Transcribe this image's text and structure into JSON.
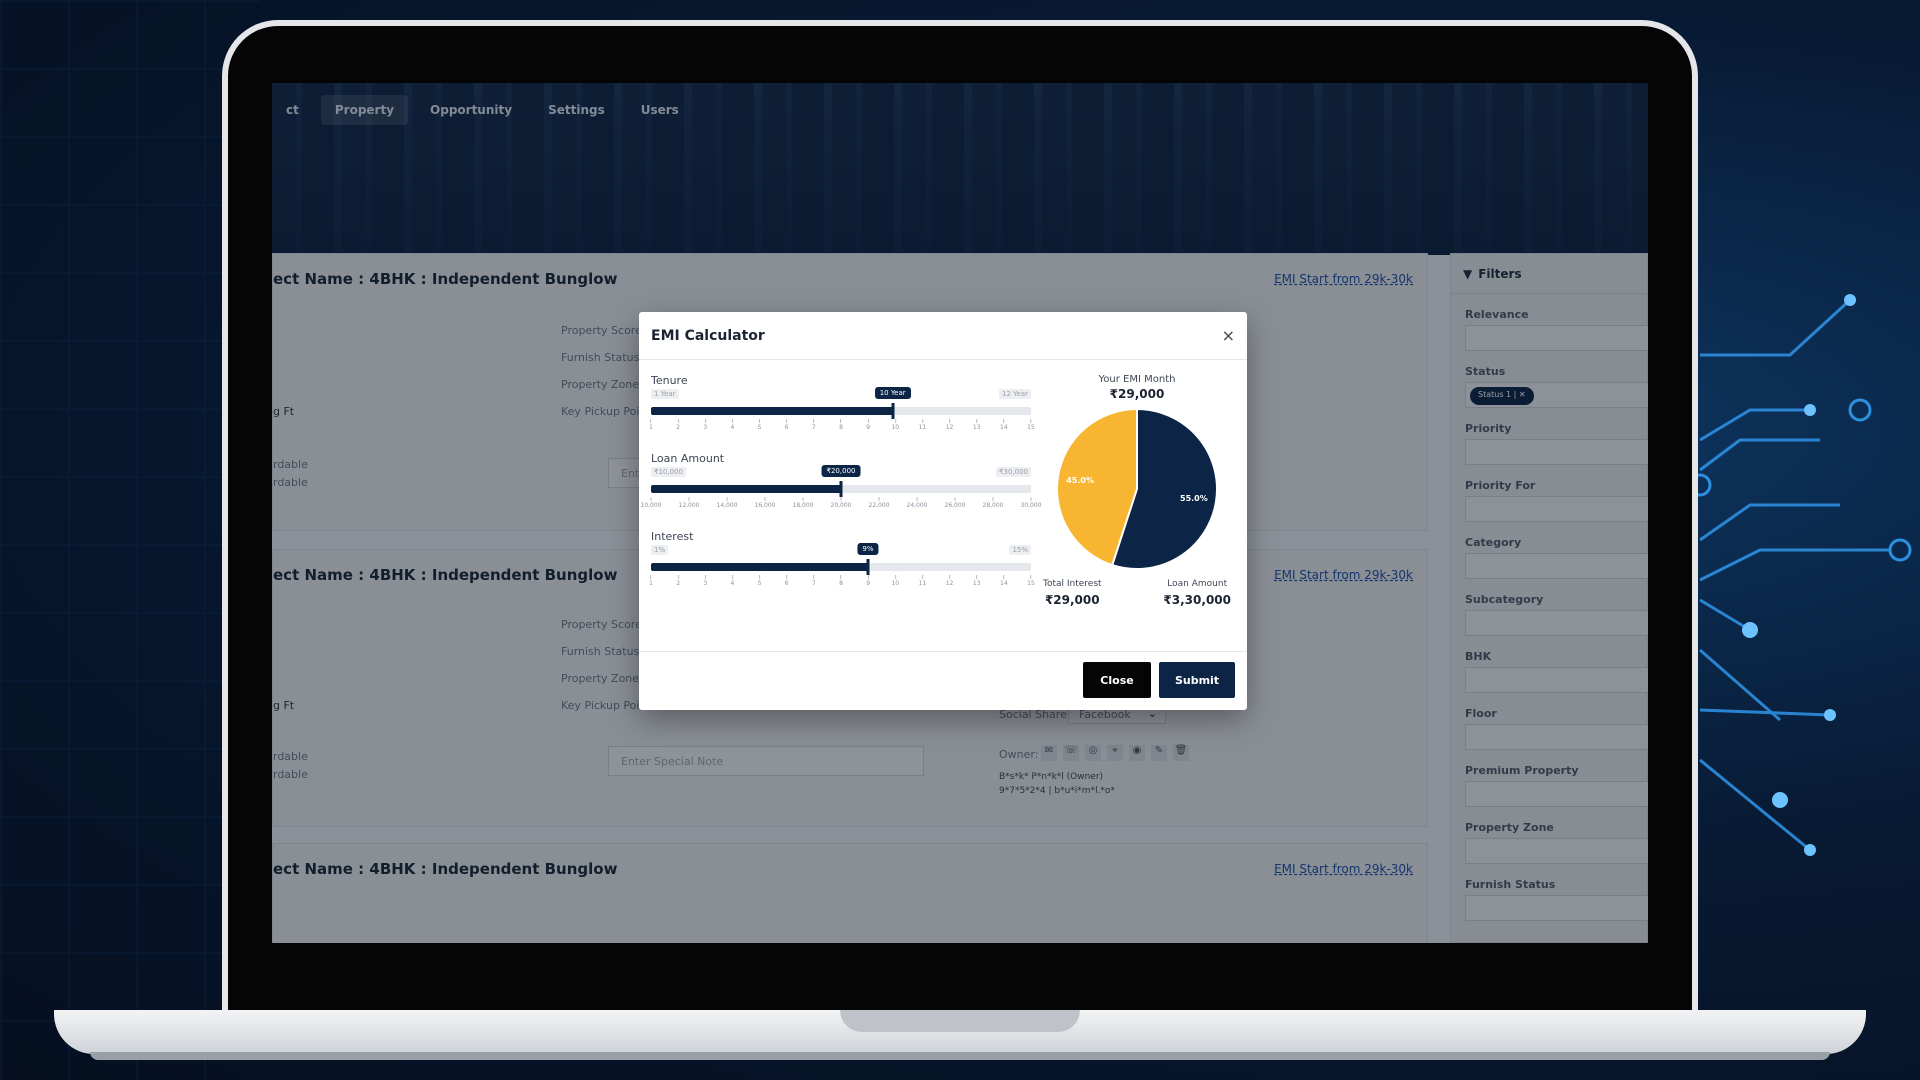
{
  "nav": {
    "items": [
      {
        "label": "ct"
      },
      {
        "label": "Property"
      },
      {
        "label": "Opportunity"
      },
      {
        "label": "Settings"
      },
      {
        "label": "Users"
      }
    ]
  },
  "cards": [
    {
      "title": "ect Name : 4BHK : Independent Bunglow",
      "emi_link": "EMI Start from 29k-30k",
      "fields": [
        "Property Score:",
        "Furnish Status: F",
        "Property Zone: ,",
        "Key Pickup Poi"
      ],
      "left_text": [
        "g Ft",
        "rdable",
        "rdable"
      ],
      "note_placeholder": "Ente"
    },
    {
      "title": "ect Name : 4BHK : Independent Bunglow",
      "emi_link": "EMI Start from 29k-30k",
      "fields": [
        "Property Score:",
        "Furnish Status:",
        "Property Zone:",
        "Key Pickup Poi"
      ],
      "left_text": [
        "g Ft",
        "rdable",
        "rdable"
      ],
      "note_placeholder": "Enter Special Note",
      "social_share_label": "Social Share:",
      "social_share_value": "Facebook",
      "owner_label": "Owner:",
      "owner_lines": [
        "B*s*k* P*n*k*l (Owner)",
        "9*7*5*2*4 | b*u*i*m*l.*o*"
      ]
    },
    {
      "title": "ect Name : 4BHK : Independent Bunglow",
      "emi_link": "EMI Start from 29k-30k"
    }
  ],
  "filters": {
    "title": "Filters",
    "groups": [
      {
        "label": "Relevance"
      },
      {
        "label": "Status",
        "chip": "Status 1"
      },
      {
        "label": "Priority"
      },
      {
        "label": "Priority For"
      },
      {
        "label": "Category"
      },
      {
        "label": "Subcategory"
      },
      {
        "label": "BHK"
      },
      {
        "label": "Floor"
      },
      {
        "label": "Premium Property"
      },
      {
        "label": "Property Zone"
      },
      {
        "label": "Furnish Status"
      }
    ]
  },
  "modal": {
    "title": "EMI Calculator",
    "close_symbol": "×",
    "tenure": {
      "label": "Tenure",
      "min_label": "1 Year",
      "max_label": "12 Year",
      "value_label": "10 Year",
      "value_fraction": 0.636,
      "ticks": [
        "1",
        "2",
        "3",
        "4",
        "5",
        "6",
        "7",
        "8",
        "9",
        "10",
        "11",
        "12",
        "13",
        "14",
        "15"
      ]
    },
    "loan": {
      "label": "Loan Amount",
      "min_label": "₹10,000",
      "max_label": "₹30,000",
      "value_label": "₹20,000",
      "value_fraction": 0.5,
      "ticks": [
        "10,000",
        "12,000",
        "14,000",
        "16,000",
        "18,000",
        "20,000",
        "22,000",
        "24,000",
        "26,000",
        "28,000",
        "30,000"
      ]
    },
    "interest": {
      "label": "Interest",
      "min_label": "1%",
      "max_label": "15%",
      "value_label": "9%",
      "value_fraction": 0.571,
      "ticks": [
        "1",
        "2",
        "3",
        "4",
        "5",
        "6",
        "7",
        "8",
        "9",
        "10",
        "11",
        "12",
        "13",
        "14",
        "15"
      ]
    },
    "emi_caption": "Your EMI Month",
    "emi_value": "₹29,000",
    "pie": {
      "slices": [
        {
          "label": "45.0%",
          "value": 45.0,
          "color": "#f8b531"
        },
        {
          "label": "55.0%",
          "value": 55.0,
          "color": "#0c2546"
        }
      ]
    },
    "total_interest_caption": "Total Interest",
    "total_interest_value": "₹29,000",
    "loan_amount_caption": "Loan Amount",
    "loan_amount_value": "₹3,30,000",
    "close_button": "Close",
    "submit_button": "Submit"
  }
}
